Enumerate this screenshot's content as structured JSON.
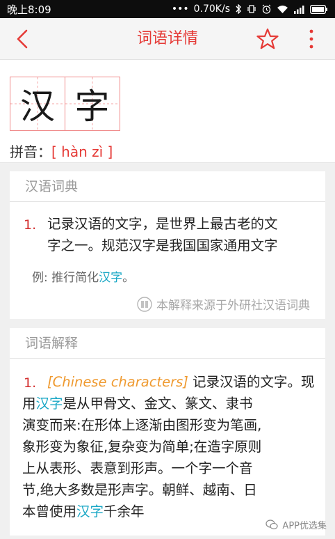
{
  "status_bar": {
    "time": "晚上8:09",
    "network_speed": "0.70K/s"
  },
  "app_bar": {
    "title": "词语详情",
    "accent_color": "#e53935"
  },
  "word": {
    "characters": [
      "汉",
      "字"
    ],
    "pinyin_label": "拼音：",
    "pinyin": "[ hàn zì ]"
  },
  "dictionary": {
    "title": "汉语词典",
    "entry_number": "1.",
    "definition_lines": [
      "记录汉语的文字，是世界上最古老的文",
      "字之一。规范汉字是我国国家通用文字"
    ],
    "example_prefix": "例: 推行简化",
    "example_highlight": "汉字",
    "example_suffix": "。",
    "source": "本解释来源于外研社汉语词典"
  },
  "explanation": {
    "title": "词语解释",
    "entry_number": "1.",
    "english": "[Chinese characters]",
    "line1_rest": " 记录汉语的文字。现",
    "line2_prefix": "用",
    "line2_highlight": "汉字",
    "line2_rest": "是从甲骨文、金文、篆文、隶书",
    "lines_middle": [
      "演变而来:在形体上逐渐由图形变为笔画,",
      "象形变为象征,复杂变为简单;在造字原则",
      "上从表形、表意到形声。一个字一个音",
      "节,绝大多数是形声字。朝鲜、越南、日"
    ],
    "last_prefix": "本曾使用",
    "last_highlight": "汉字",
    "last_suffix": "千余年"
  },
  "watermark": "APP优选集"
}
